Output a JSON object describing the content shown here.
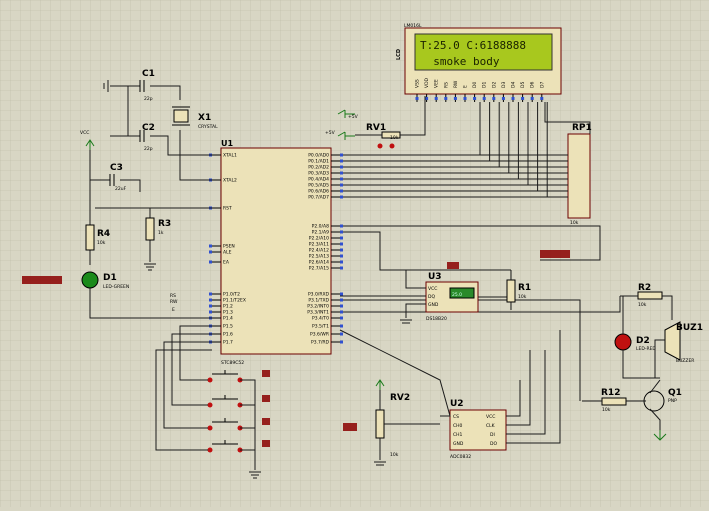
{
  "lcd": {
    "ref": "LCD",
    "part": "LM016L",
    "line1": "T:25.0 C:6188888",
    "line2": "  smoke body",
    "pins": [
      "VSS",
      "VDD",
      "VEE",
      "RS",
      "RW",
      "E",
      "D0",
      "D1",
      "D2",
      "D3",
      "D4",
      "D5",
      "D6",
      "D7"
    ]
  },
  "u1": {
    "ref": "U1",
    "part": "STC89C52",
    "left_pins": [
      "XTAL1",
      "XTAL2",
      "RST",
      "PSEN",
      "ALE",
      "EA",
      "P1.0/T2",
      "P1.1/T2EX",
      "P1.2",
      "P1.3",
      "P1.4",
      "P1.5",
      "P1.6",
      "P1.7"
    ],
    "right_pins": [
      "P0.0/AD0",
      "P0.1/AD1",
      "P0.2/AD2",
      "P0.3/AD3",
      "P0.4/AD4",
      "P0.5/AD5",
      "P0.6/AD6",
      "P0.7/AD7",
      "P2.0/A8",
      "P2.1/A9",
      "P2.2/A10",
      "P2.3/A11",
      "P2.4/A12",
      "P2.5/A13",
      "P2.6/A14",
      "P2.7/A15",
      "P3.0/RXD",
      "P3.1/TXD",
      "P3.2/INT0",
      "P3.3/INT1",
      "P3.4/T0",
      "P3.5/T1",
      "P3.6/WR",
      "P3.7/RD"
    ]
  },
  "components": {
    "c1": "C1",
    "c1_val": "22p",
    "c2": "C2",
    "c2_val": "22p",
    "x1": "X1",
    "x1_val": "CRYSTAL",
    "c3": "C3",
    "c3_val": "22uF",
    "r3": "R3",
    "r3_val": "1k",
    "r4": "R4",
    "r4_val": "10k",
    "d1": "D1",
    "d1_val": "LED-GREEN",
    "rv1": "RV1",
    "rv1_val": "10k",
    "rp1": "RP1",
    "rp1_val": "10k",
    "u3": "U3",
    "u3_part": "DS18B20",
    "u3_reading": "25.0",
    "r1": "R1",
    "r1_val": "10k",
    "r2": "R2",
    "r2_val": "10k",
    "d2": "D2",
    "d2_val": "LED-RED",
    "buz1": "BUZ1",
    "buz1_val": "BUZZER",
    "r12": "R12",
    "r12_val": "10k",
    "q1": "Q1",
    "q1_val": "PNP",
    "rv2": "RV2",
    "rv2_val": "10k",
    "u2": "U2",
    "u2_part": "ADC0832",
    "vcc": "VCC",
    "rs": "RS",
    "rw": "RW",
    "e": "E",
    "text_tag": "<TEXT>"
  },
  "colors": {
    "lcd_bg": "#a8c81e",
    "wire": "#1a1a1a",
    "body": "#ece2b8",
    "outline": "#6b0000",
    "led_green": "#1a8a1a",
    "led_red": "#c01010"
  }
}
